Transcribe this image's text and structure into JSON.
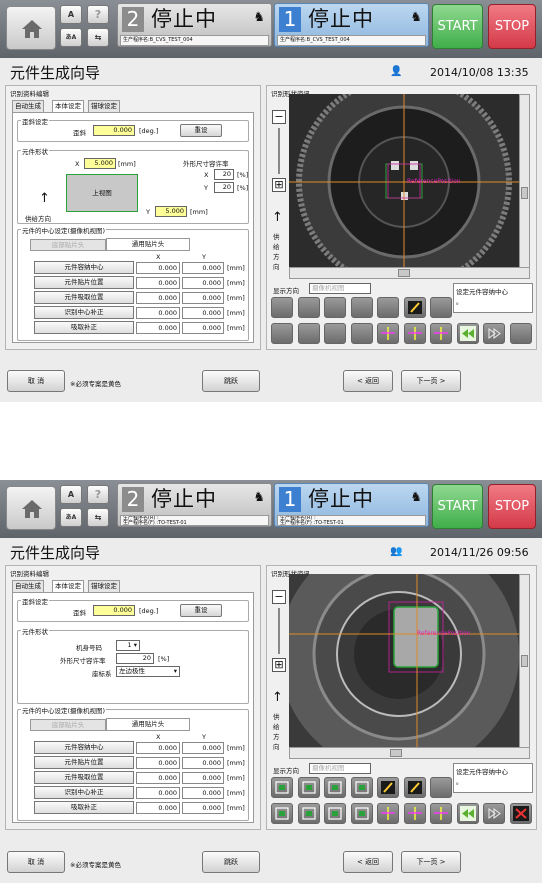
{
  "screens": [
    {
      "topbar": {
        "lane2": {
          "num": "2",
          "status": "停止中",
          "program": "生产程序名:B_CVS_TEST_004"
        },
        "lane1": {
          "num": "1",
          "status": "停止中",
          "program": "生产程序名:B_CVS_TEST_004"
        },
        "start": "START",
        "stop": "STOP"
      },
      "title": "元件生成向导",
      "datetime": "2014/10/08 13:35",
      "left_panel": {
        "label": "识别资料编辑",
        "tabs": [
          "自动生成",
          "本体设定",
          "锚球设定"
        ],
        "skew_group": "歪斜设定",
        "skew_label": "歪斜",
        "skew_value": "0.000",
        "skew_unit": "[deg.]",
        "reset": "重设",
        "shape_group": "元件形状",
        "x_label": "X",
        "x_value": "5.000",
        "x_unit": "[mm]",
        "tol_title": "外形尺寸容许率",
        "tol_x_label": "X",
        "tol_x": "20",
        "tol_x_unit": "[%]",
        "tol_y_label": "Y",
        "tol_y": "20",
        "tol_y_unit": "[%]",
        "shape_text": "上视图",
        "supply_dir": "供给方向",
        "y_label": "Y",
        "y_value": "5.000",
        "y_unit": "[mm]",
        "center_group": "元件的中心设定(摄像机视图)",
        "subtabs": [
          "底部贴片头",
          "通用贴片头"
        ],
        "col_x": "X",
        "col_y": "Y",
        "rows": [
          {
            "label": "元件容纳中心",
            "x": "0.000",
            "y": "0.000",
            "unit": "[mm]"
          },
          {
            "label": "元件贴片位置",
            "x": "0.000",
            "y": "0.000",
            "unit": "[mm]"
          },
          {
            "label": "元件吸取位置",
            "x": "0.000",
            "y": "0.000",
            "unit": "[mm]"
          },
          {
            "label": "识别中心补正",
            "x": "0.000",
            "y": "0.000",
            "unit": "[mm]"
          },
          {
            "label": "吸取补正",
            "x": "0.000",
            "y": "0.000",
            "unit": "[mm]"
          }
        ]
      },
      "right_panel": {
        "label": "识别形状资讯",
        "supply_vertical": [
          "供",
          "给",
          "方",
          "向"
        ],
        "display_dir": "显示方向",
        "display_dir_value": "摄像机视图",
        "hint": "设定元件容纳中心",
        "hint2": "。",
        "overlay": "ReferencePosition"
      },
      "bottom": {
        "cancel": "取 消",
        "note": "※必须专案是黄色",
        "skip": "跳跃",
        "back": "< 返回",
        "next": "下一页 >"
      }
    },
    {
      "topbar": {
        "lane2": {
          "num": "2",
          "status": "停止中",
          "program_a": "生产程序名(R) :",
          "program_b": "生产程序名(F) :TO-TEST-01"
        },
        "lane1": {
          "num": "1",
          "status": "停止中",
          "program_a": "生产程序名(R) :",
          "program_b": "生产程序名(F) :TO-TEST-01"
        },
        "start": "START",
        "stop": "STOP"
      },
      "title": "元件生成向导",
      "datetime": "2014/11/26 09:56",
      "left_panel": {
        "label": "识别资料编辑",
        "tabs": [
          "自动生成",
          "本体设定",
          "锚球设定"
        ],
        "skew_group": "歪斜设定",
        "skew_label": "歪斜",
        "skew_value": "0.000",
        "skew_unit": "[deg.]",
        "reset": "重设",
        "shape_group": "元件形状",
        "model_label": "机身号码",
        "model_value": "1",
        "tol_label": "外形尺寸容许率",
        "tol_value": "20",
        "tol_unit": "[%]",
        "coord_label": "座标系",
        "coord_value": "左边极性",
        "center_group": "元件的中心设定(摄像机视图)",
        "subtabs": [
          "底部贴片头",
          "通用贴片头"
        ],
        "col_x": "X",
        "col_y": "Y",
        "rows": [
          {
            "label": "元件容纳中心",
            "x": "0.000",
            "y": "0.000",
            "unit": "[mm]"
          },
          {
            "label": "元件贴片位置",
            "x": "0.000",
            "y": "0.000",
            "unit": "[mm]"
          },
          {
            "label": "元件吸取位置",
            "x": "0.000",
            "y": "0.000",
            "unit": "[mm]"
          },
          {
            "label": "识别中心补正",
            "x": "0.000",
            "y": "0.000",
            "unit": "[mm]"
          },
          {
            "label": "吸取补正",
            "x": "0.000",
            "y": "0.000",
            "unit": "[mm]"
          }
        ]
      },
      "right_panel": {
        "label": "识别形状资讯",
        "supply_vertical": [
          "供",
          "给",
          "方",
          "向"
        ],
        "display_dir": "显示方向",
        "display_dir_value": "摄像机视图",
        "hint": "设定元件容纳中心",
        "hint2": "。",
        "overlay": "ReferencePosition"
      },
      "bottom": {
        "cancel": "取 消",
        "note": "※必须专案是黄色",
        "skip": "跳跃",
        "back": "< 返回",
        "next": "下一页 >"
      }
    }
  ]
}
